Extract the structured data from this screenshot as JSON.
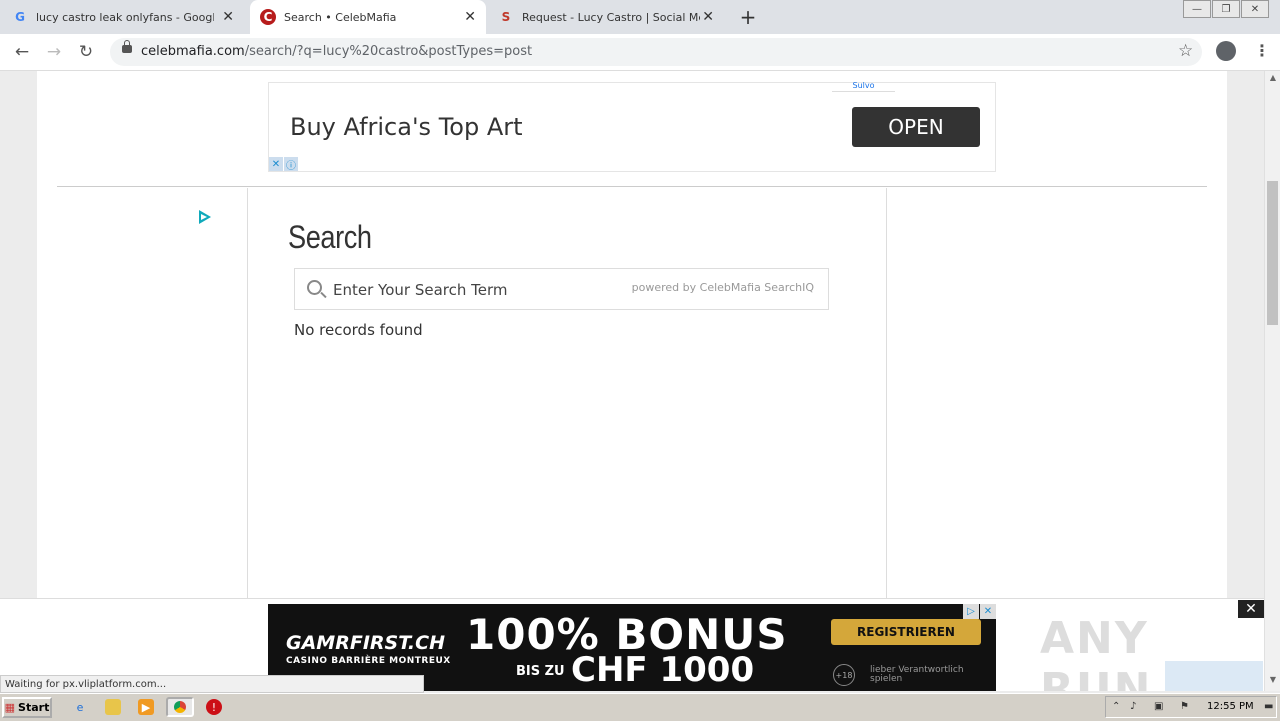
{
  "browser": {
    "tabs": [
      {
        "title": "lucy castro leak onlyfans - Google Se",
        "favicon": "G"
      },
      {
        "title": "Search • CelebMafia",
        "favicon": "C"
      },
      {
        "title": "Request - Lucy Castro | Social Media",
        "favicon": "S"
      }
    ],
    "url_domain": "celebmafia.com",
    "url_path": "/search/?q=lucy%20castro&postTypes=post"
  },
  "top_ad": {
    "label": "Sulvo",
    "title": "Buy Africa's Top Art",
    "button": "OPEN",
    "close_glyph": "✕",
    "info_glyph": "ⓘ"
  },
  "search": {
    "heading": "Search",
    "placeholder": "Enter Your Search Term",
    "powered_by": "powered by CelebMafia SearchIQ",
    "no_results": "No records found"
  },
  "bottom_ad": {
    "brand": "GAMRFIRST.CH",
    "brand_sub": "CASINO BARRIÈRE MONTREUX",
    "headline": "100% BONUS",
    "bis": "BIS ZU",
    "amount": "CHF 1000",
    "cta": "REGISTRIEREN",
    "age": "+18",
    "responsible": "lieber Verantwortlich spielen"
  },
  "watermark": "ANY RUN",
  "status_text": "Waiting for px.vliplatform.com...",
  "taskbar": {
    "start": "Start",
    "clock": "12:55 PM"
  },
  "colors": {
    "accent": "#1a73e8",
    "ad_button": "#333333",
    "bonus_gold": "#d4a73a"
  }
}
